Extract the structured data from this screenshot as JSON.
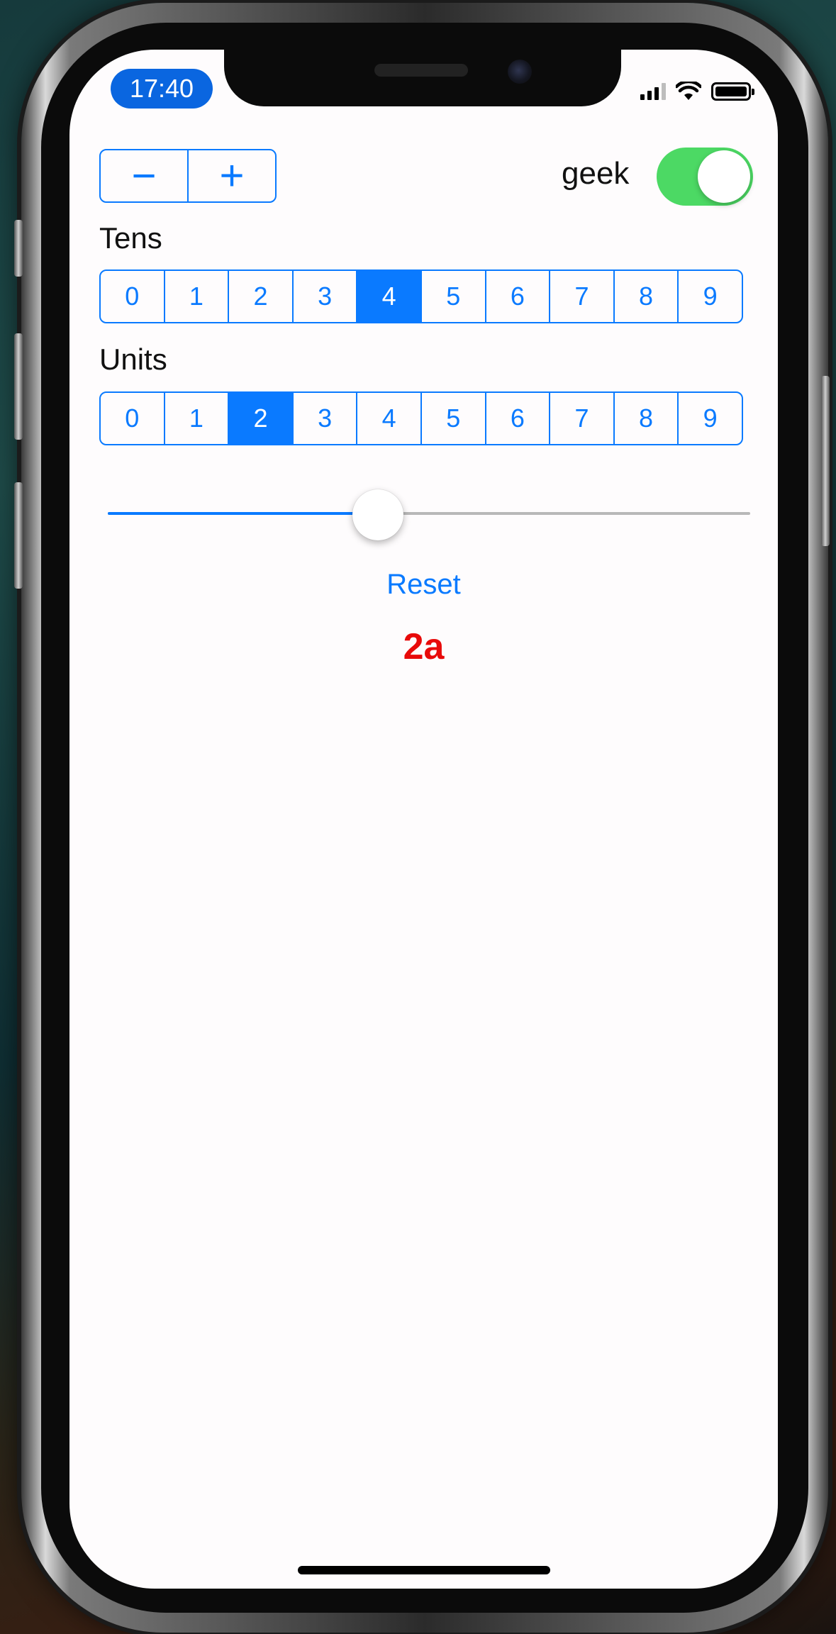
{
  "status_bar": {
    "time": "17:40"
  },
  "stepper": {
    "minus_label": "−",
    "plus_label": "+"
  },
  "geek_toggle": {
    "label": "geek",
    "on": true,
    "color": "#4cd964"
  },
  "tens": {
    "label": "Tens",
    "options": [
      "0",
      "1",
      "2",
      "3",
      "4",
      "5",
      "6",
      "7",
      "8",
      "9"
    ],
    "selected": "4"
  },
  "units": {
    "label": "Units",
    "options": [
      "0",
      "1",
      "2",
      "3",
      "4",
      "5",
      "6",
      "7",
      "8",
      "9"
    ],
    "selected": "2"
  },
  "slider": {
    "value_fraction": 0.42
  },
  "reset_label": "Reset",
  "result_text": "2a",
  "colors": {
    "accent": "#0a7aff",
    "result": "#e80a0a"
  }
}
